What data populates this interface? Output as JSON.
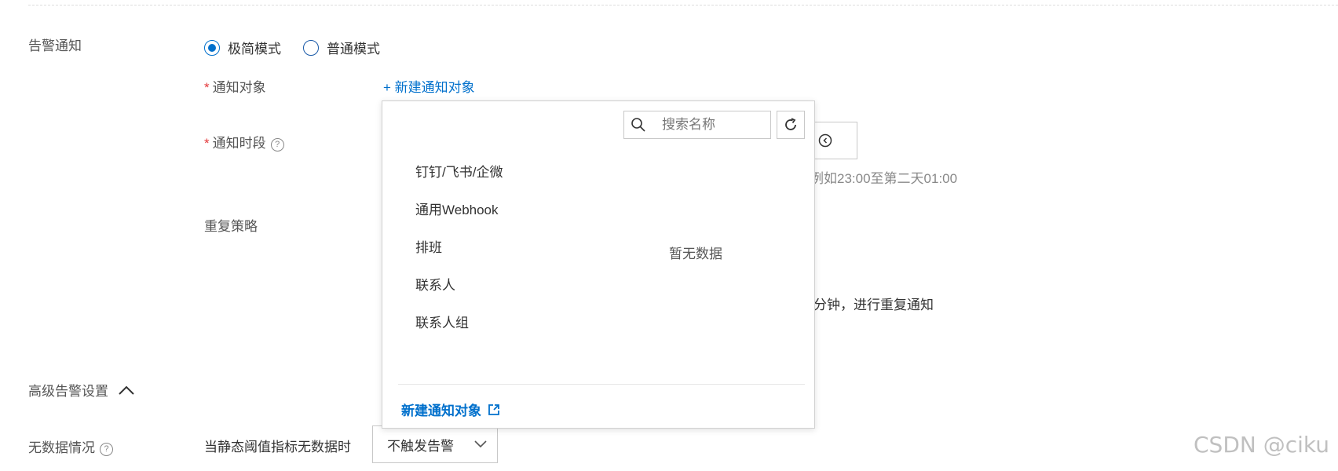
{
  "alert_notify": {
    "label": "告警通知",
    "modes": [
      {
        "label": "极简模式",
        "checked": true
      },
      {
        "label": "普通模式",
        "checked": false
      }
    ]
  },
  "notify_target": {
    "required_mark": "*",
    "label": "通知对象",
    "new_link": "+ 新建通知对象"
  },
  "notify_period": {
    "required_mark": "*",
    "label": "通知时段",
    "help": "?",
    "hint_fragment": "例如23:00至第二天01:00"
  },
  "repeat_policy": {
    "label": "重复策略",
    "text_fragment": "分钟，进行重复通知"
  },
  "popup": {
    "search_placeholder": "搜索名称",
    "categories": [
      "钉钉/飞书/企微",
      "通用Webhook",
      "排班",
      "联系人",
      "联系人组"
    ],
    "empty_text": "暂无数据",
    "footer_link": "新建通知对象"
  },
  "advanced": {
    "label": "高级告警设置"
  },
  "no_data": {
    "label": "无数据情况",
    "help": "?",
    "condition_label": "当静态阈值指标无数据时",
    "select_value": "不触发告警"
  },
  "watermark": "CSDN @ciku",
  "colors": {
    "accent": "#0070cc",
    "required": "#e4393c"
  }
}
